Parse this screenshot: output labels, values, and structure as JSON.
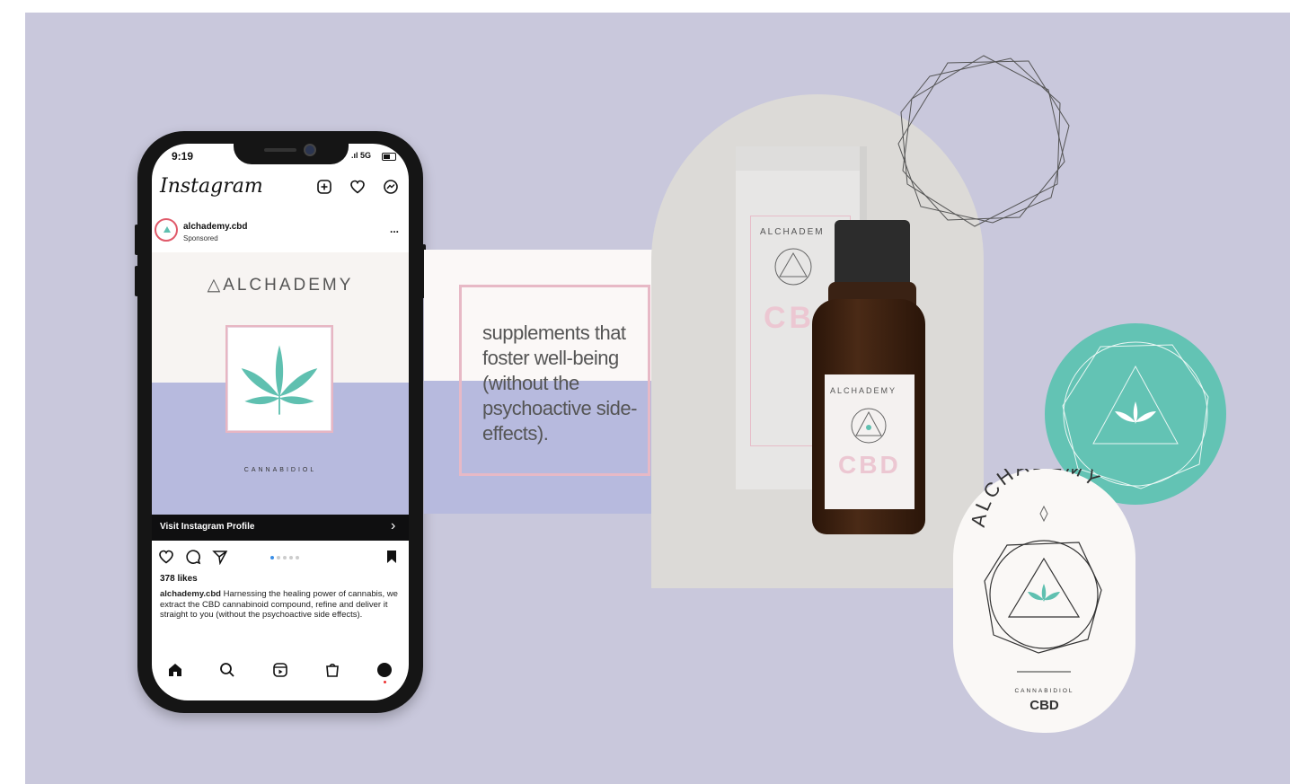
{
  "phone": {
    "time": "9:19",
    "signal": "5G",
    "app_logo": "Instagram",
    "icons": [
      "add-post-icon",
      "heart-icon",
      "messenger-icon"
    ],
    "account_name": "alchademy.cbd",
    "sponsored_label": "Sponsored",
    "more_label": "...",
    "post": {
      "brand": "ALCHADEMY",
      "subtitle": "CANNABIDIOL"
    },
    "visit_label": "Visit Instagram Profile",
    "likes": "378 likes",
    "caption_user": "alchademy.cbd",
    "caption_text": "Harnessing the healing power of cannabis, we extract the CBD cannabinoid compound, refine and deliver it straight to you (without the psychoactive side effects).",
    "nav_icons": [
      "home-icon",
      "search-icon",
      "reels-icon",
      "shop-icon",
      "profile-icon"
    ]
  },
  "card": {
    "text": "supplements that foster well-being (without the psychoactive side-effects)."
  },
  "product": {
    "box_brand": "ALCHADEM",
    "box_cbd": "CB",
    "bottle_brand": "ALCHADEMY",
    "bottle_cbd": "CBD"
  },
  "sticker": {
    "arc_text": "ALCHADEMY",
    "cannabidiol": "CANNABIDIOL",
    "cbd": "CBD"
  },
  "colors": {
    "background": "#c9c8dc",
    "lavender": "#b7bade",
    "pink": "#e7b6c3",
    "teal": "#63c3b4"
  }
}
